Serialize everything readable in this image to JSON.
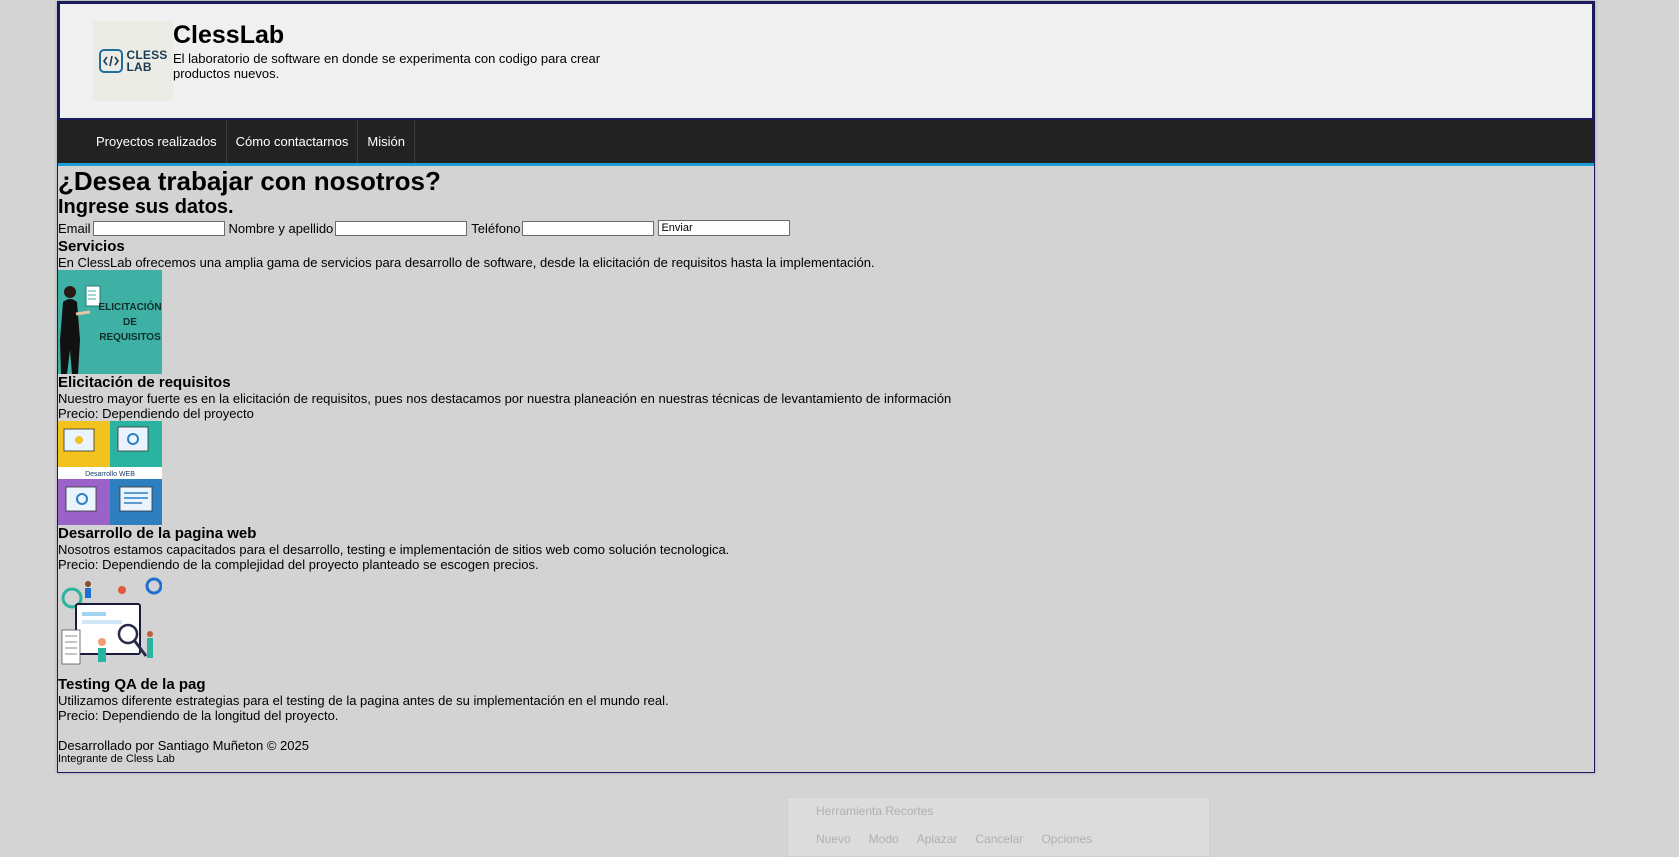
{
  "header": {
    "logo_text": "CLESS LAB",
    "title": "ClessLab",
    "tagline": "El laboratorio de software en donde se experimenta con codigo para crear productos nuevos."
  },
  "nav": {
    "items": [
      "Proyectos realizados",
      "Cómo contactarnos",
      "Misión"
    ]
  },
  "contact": {
    "heading": "¿Desea trabajar con nosotros?",
    "subheading": "Ingrese sus datos.",
    "email_label": "Email",
    "email_value": "",
    "name_label": "Nombre y apellido",
    "name_value": "",
    "phone_label": "Teléfono",
    "phone_value": "",
    "submit_label": "Enviar"
  },
  "services": {
    "heading": "Servicios",
    "intro": "En ClessLab ofrecemos una amplia gama de servicios para desarrollo de software, desde la elicitación de requisitos hasta la implementación.",
    "items": [
      {
        "image_text": "ELICITACIÓN DE REQUISITOS",
        "title": "Elicitación de requisitos",
        "description": "Nuestro mayor fuerte es en la elicitación de requisitos, pues nos destacamos por nuestra planeación en nuestras técnicas de levantamiento de información",
        "price": "Precio: Dependiendo del proyecto"
      },
      {
        "image_text": "Desarrollo WEB",
        "title": "Desarrollo de la pagina web",
        "description": "Nosotros estamos capacitados para el desarrollo, testing e implementación de sitios web como solución tecnologica.",
        "price": "Precio: Dependiendo de la complejidad del proyecto planteado se escogen precios."
      },
      {
        "image_text": "",
        "title": "Testing QA de la pag",
        "description": "Utilizamos diferente estrategias para el testing de la pagina antes de su implementación en el mundo real.",
        "price": "Precio: Dependiendo de la longitud del proyecto."
      }
    ]
  },
  "footer": {
    "credit": "Desarrollado por Santiago Muñeton © 2025",
    "member": "Integrante de Cless Lab"
  },
  "snipping_tool": {
    "title": "Herramienta Recortes",
    "buttons": [
      "Nuevo",
      "Modo",
      "Aplazar",
      "Cancelar",
      "Opciones"
    ]
  },
  "colors": {
    "nav_bg": "#222222",
    "nav_accent": "#1e9fd8",
    "page_bg": "#d3d3d3",
    "header_bg": "#f0f0f0"
  }
}
